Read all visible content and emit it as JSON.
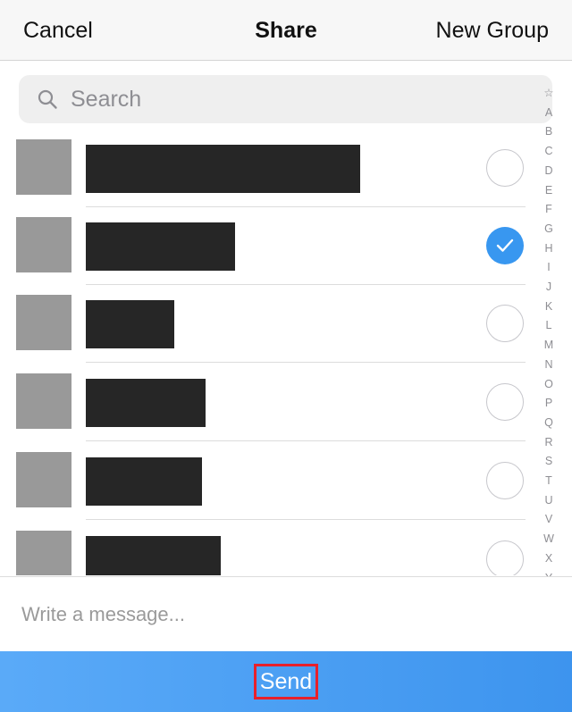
{
  "header": {
    "cancel": "Cancel",
    "title": "Share",
    "new_group": "New Group"
  },
  "search": {
    "placeholder": "Search",
    "icon": "search-icon"
  },
  "contacts": [
    {
      "selected": false
    },
    {
      "selected": true
    },
    {
      "selected": false
    },
    {
      "selected": false
    },
    {
      "selected": false
    },
    {
      "selected": false
    }
  ],
  "index_letters": [
    "☆",
    "A",
    "B",
    "C",
    "D",
    "E",
    "F",
    "G",
    "H",
    "I",
    "J",
    "K",
    "L",
    "M",
    "N",
    "O",
    "P",
    "Q",
    "R",
    "S",
    "T",
    "U",
    "V",
    "W",
    "X",
    "Y"
  ],
  "compose": {
    "placeholder": "Write a message..."
  },
  "send_bar": {
    "send_label": "Send"
  },
  "colors": {
    "accent": "#3897f0",
    "highlight_border": "#e8202a",
    "redaction": "#262626",
    "avatar_placeholder": "#999999"
  }
}
